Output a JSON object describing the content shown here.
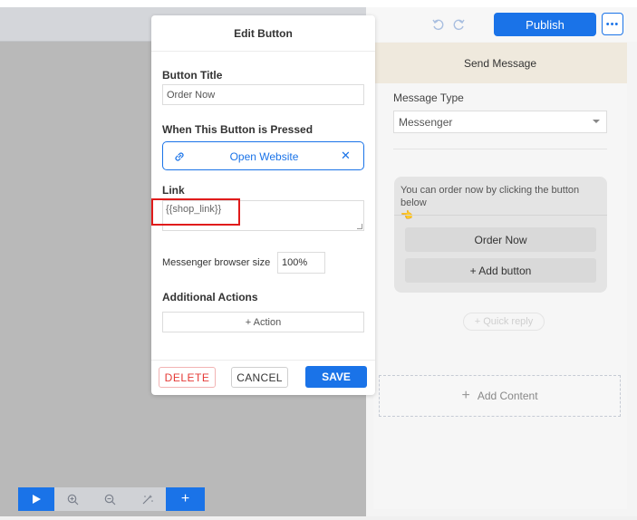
{
  "header": {
    "publish_label": "Publish",
    "more_label": "•••"
  },
  "send_message": {
    "title": "Send Message",
    "message_type_label": "Message Type",
    "message_type_value": "Messenger",
    "card_text": "You can order now by clicking the button below",
    "card_emoji": "👈",
    "buttons": [
      "Order Now",
      "+ Add button"
    ],
    "quick_reply": "+ Quick reply",
    "add_content": "Add Content"
  },
  "edit_button": {
    "title": "Edit Button",
    "button_title_label": "Button Title",
    "button_title_value": "Order Now",
    "pressed_label": "When This Button is Pressed",
    "pressed_action": "Open Website",
    "link_label": "Link",
    "link_value": "{{shop_link}}",
    "browser_size_label": "Messenger browser size",
    "browser_size_value": "100%",
    "additional_actions_label": "Additional Actions",
    "action_button": "+ Action",
    "delete": "DELETE",
    "cancel": "CANCEL",
    "save": "SAVE"
  },
  "colors": {
    "accent": "#1a73e8",
    "danger": "#e53935",
    "highlight": "#e01b1b"
  },
  "icons": [
    "undo-icon",
    "redo-icon",
    "link-icon",
    "close-icon",
    "play-icon",
    "zoom-in-icon",
    "zoom-out-icon",
    "magic-icon",
    "plus-icon",
    "caret-down-icon"
  ]
}
